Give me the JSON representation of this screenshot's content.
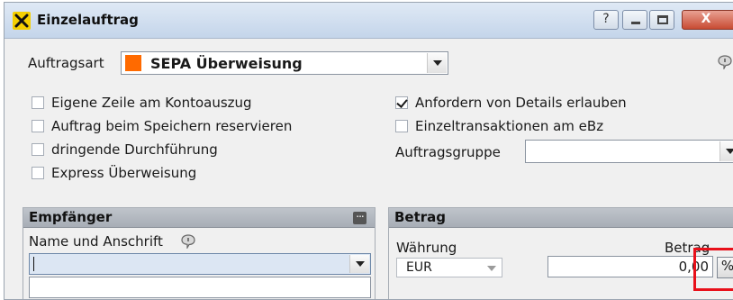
{
  "window": {
    "title": "Einzelauftrag",
    "controls": {
      "help": "?",
      "close": "X"
    }
  },
  "order_type": {
    "label": "Auftragsart",
    "value": "SEPA Überweisung",
    "swatch_color": "#ff6a00"
  },
  "options_left": [
    {
      "label": "Eigene Zeile am Kontoauszug",
      "checked": false
    },
    {
      "label": "Auftrag beim Speichern reservieren",
      "checked": false
    },
    {
      "label": "dringende Durchführung",
      "checked": false
    },
    {
      "label": "Express Überweisung",
      "checked": false
    }
  ],
  "options_right": [
    {
      "label": "Anfordern von Details erlauben",
      "checked": true
    },
    {
      "label": "Einzeltransaktionen am eBz",
      "checked": false
    }
  ],
  "order_group": {
    "label": "Auftragsgruppe",
    "value": ""
  },
  "recipient": {
    "title": "Empfänger",
    "more_button": "...",
    "name_label": "Name und Anschrift",
    "name_value": ""
  },
  "amount": {
    "title": "Betrag",
    "currency_label": "Währung",
    "currency_value": "EUR",
    "amount_label": "Betrag",
    "amount_value": "0,00",
    "percent_button": "%"
  },
  "colors": {
    "highlight": "#e8101a",
    "accent": "#f4cf00"
  }
}
